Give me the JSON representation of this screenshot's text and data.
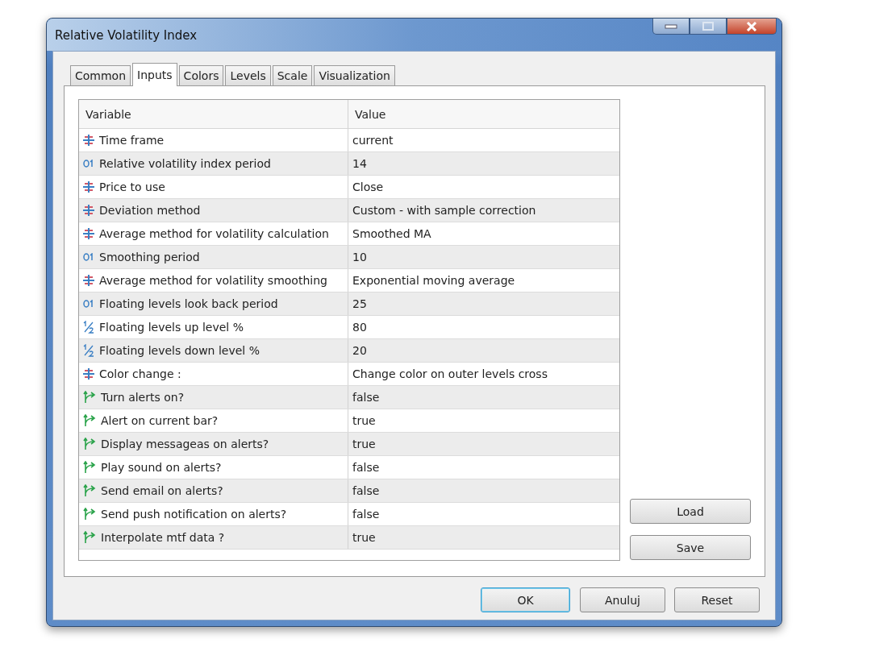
{
  "window": {
    "title": "Relative Volatility Index"
  },
  "tabs": [
    {
      "label": "Common",
      "selected": false
    },
    {
      "label": "Inputs",
      "selected": true
    },
    {
      "label": "Colors",
      "selected": false
    },
    {
      "label": "Levels",
      "selected": false
    },
    {
      "label": "Scale",
      "selected": false
    },
    {
      "label": "Visualization",
      "selected": false
    }
  ],
  "table": {
    "columns": [
      "Variable",
      "Value"
    ],
    "rows": [
      {
        "kind": "enum",
        "variable": "Time frame",
        "value": "current"
      },
      {
        "kind": "int",
        "variable": "Relative volatility index period",
        "value": "14"
      },
      {
        "kind": "enum",
        "variable": "Price to use",
        "value": "Close"
      },
      {
        "kind": "enum",
        "variable": "Deviation method",
        "value": "Custom - with sample correction"
      },
      {
        "kind": "enum",
        "variable": "Average method for volatility calculation",
        "value": "Smoothed MA"
      },
      {
        "kind": "int",
        "variable": "Smoothing period",
        "value": "10"
      },
      {
        "kind": "enum",
        "variable": "Average method for volatility smoothing",
        "value": "Exponential moving average"
      },
      {
        "kind": "int",
        "variable": "Floating levels look back period",
        "value": "25"
      },
      {
        "kind": "double",
        "variable": "Floating levels up level %",
        "value": "80"
      },
      {
        "kind": "double",
        "variable": "Floating levels down level %",
        "value": "20"
      },
      {
        "kind": "enum",
        "variable": "Color change :",
        "value": "Change color on outer levels cross"
      },
      {
        "kind": "bool",
        "variable": "Turn alerts on?",
        "value": "false"
      },
      {
        "kind": "bool",
        "variable": "Alert on current bar?",
        "value": "true"
      },
      {
        "kind": "bool",
        "variable": "Display messageas on alerts?",
        "value": "true"
      },
      {
        "kind": "bool",
        "variable": "Play sound on alerts?",
        "value": "false"
      },
      {
        "kind": "bool",
        "variable": "Send email on alerts?",
        "value": "false"
      },
      {
        "kind": "bool",
        "variable": "Send push notification on alerts?",
        "value": "false"
      },
      {
        "kind": "bool",
        "variable": "Interpolate mtf data ?",
        "value": "true"
      }
    ]
  },
  "side_buttons": [
    "Load",
    "Save"
  ],
  "buttons": [
    {
      "label": "OK",
      "default": true
    },
    {
      "label": "Anuluj",
      "default": false
    },
    {
      "label": "Reset",
      "default": false
    }
  ]
}
